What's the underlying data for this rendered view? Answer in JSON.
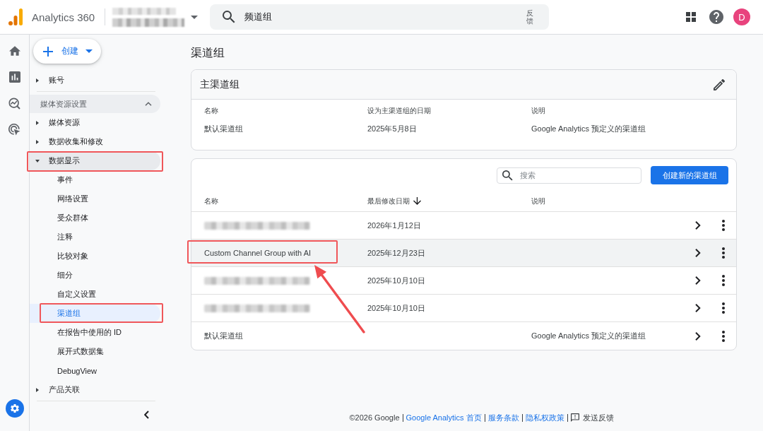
{
  "top_bar": {
    "product": "Analytics 360",
    "account_selector": {
      "blurred": true
    },
    "search": {
      "value": "频道组",
      "feedback_label": "反馈"
    },
    "avatar": {
      "initial": "D"
    }
  },
  "sidebar": {
    "create_button": {
      "label": "创建"
    },
    "nav": [
      {
        "kind": "item",
        "label": "账号",
        "expanded": false,
        "highlighted": false
      },
      {
        "kind": "section",
        "label": "媒体资源设置",
        "expanded": true,
        "children": [
          {
            "kind": "item",
            "label": "媒体资源",
            "expanded": false,
            "highlighted": false
          },
          {
            "kind": "item",
            "label": "数据收集和修改",
            "expanded": false,
            "highlighted": false
          },
          {
            "kind": "item",
            "label": "数据显示",
            "expanded": true,
            "highlighted": true,
            "children": [
              {
                "label": "事件",
                "selected": false,
                "highlighted": false
              },
              {
                "label": "网络设置",
                "selected": false,
                "highlighted": false
              },
              {
                "label": "受众群体",
                "selected": false,
                "highlighted": false
              },
              {
                "label": "注释",
                "selected": false,
                "highlighted": false
              },
              {
                "label": "比较对象",
                "selected": false,
                "highlighted": false
              },
              {
                "label": "细分",
                "selected": false,
                "highlighted": false
              },
              {
                "label": "自定义设置",
                "selected": false,
                "highlighted": false
              },
              {
                "label": "渠道组",
                "selected": true,
                "highlighted": true
              },
              {
                "label": "在报告中使用的 ID",
                "selected": false,
                "highlighted": false
              },
              {
                "label": "展开式数据集",
                "selected": false,
                "highlighted": false
              },
              {
                "label": "DebugView",
                "selected": false,
                "highlighted": false
              }
            ]
          },
          {
            "kind": "item",
            "label": "产品关联",
            "expanded": false,
            "highlighted": false
          }
        ]
      }
    ]
  },
  "page": {
    "title": "渠道组"
  },
  "primary_card": {
    "title": "主渠道组",
    "columns": [
      "名称",
      "设为主渠道组的日期",
      "说明"
    ],
    "values": [
      "默认渠道组",
      "2025年5月8日",
      "Google Analytics 预定义的渠道组"
    ]
  },
  "groups_table": {
    "search": {
      "placeholder": "搜索"
    },
    "create_button": "创建新的渠道组",
    "columns": [
      {
        "label": "名称",
        "sorted": false
      },
      {
        "label": "最后修改日期",
        "sorted": true
      },
      {
        "label": "说明",
        "sorted": false
      }
    ],
    "rows": [
      {
        "blurred": true,
        "modified": "2026年1月12日",
        "hovered": false,
        "highlighted": false
      },
      {
        "blurred": false,
        "name": "Custom Channel Group with AI",
        "modified": "2025年12月23日",
        "hovered": true,
        "highlighted": true
      },
      {
        "blurred": true,
        "modified": "2025年10月10日",
        "hovered": false,
        "highlighted": false
      },
      {
        "blurred": true,
        "modified": "2025年10月10日",
        "hovered": false,
        "highlighted": false
      },
      {
        "blurred": false,
        "name": "默认渠道组",
        "description": "Google Analytics 预定义的渠道组",
        "hovered": false,
        "highlighted": false
      }
    ],
    "pointer_arrow": true
  },
  "footer": {
    "items": [
      {
        "kind": "text",
        "text": "©2026 Google"
      },
      {
        "kind": "link",
        "text": "Google Analytics 首页"
      },
      {
        "kind": "link",
        "text": "服务条款"
      },
      {
        "kind": "link",
        "text": "隐私权政策"
      },
      {
        "kind": "feedback",
        "text": "发送反馈"
      }
    ]
  }
}
